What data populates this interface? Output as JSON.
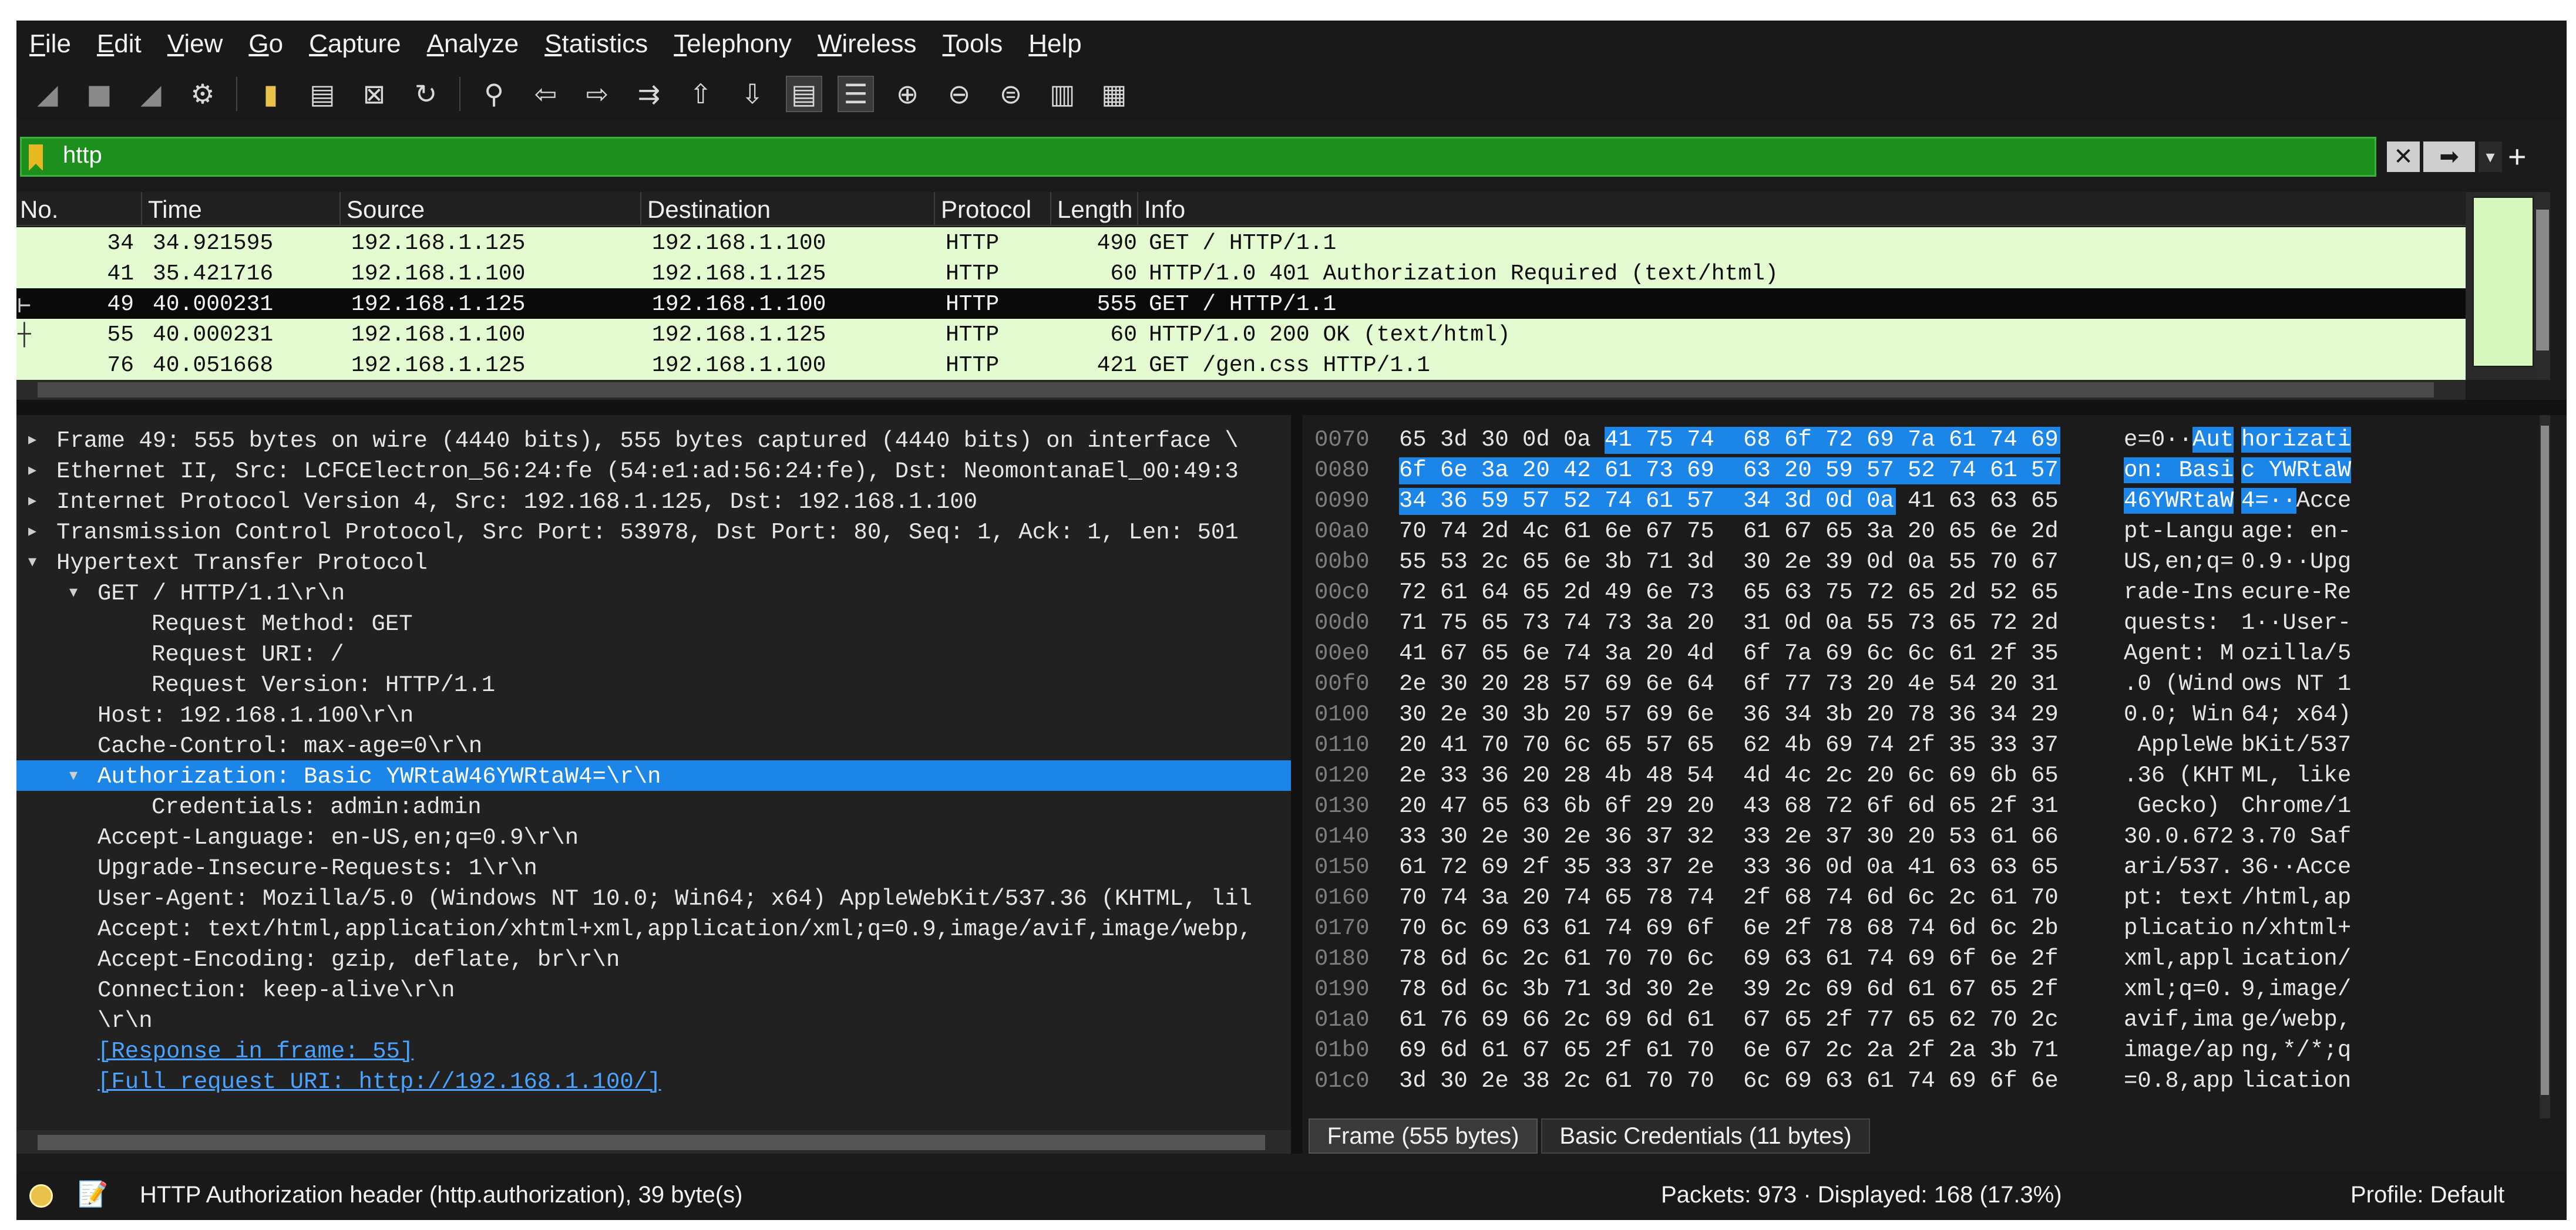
{
  "menu": [
    "File",
    "Edit",
    "View",
    "Go",
    "Capture",
    "Analyze",
    "Statistics",
    "Telephony",
    "Wireless",
    "Tools",
    "Help"
  ],
  "toolbar_icons": [
    "shark-fin-start-icon",
    "stop-icon",
    "restart-icon",
    "options-gear-icon",
    "open-file-icon",
    "save-file-icon",
    "close-file-icon",
    "reload-icon",
    "find-icon",
    "go-back-icon",
    "go-forward-icon",
    "go-to-packet-icon",
    "first-packet-icon",
    "last-packet-icon",
    "autoscroll-icon",
    "colorize-icon",
    "zoom-in-icon",
    "zoom-out-icon",
    "normal-size-icon",
    "resize-columns-icon",
    "layout-icon"
  ],
  "filter": {
    "value": "http"
  },
  "packet_list": {
    "headers": [
      "No.",
      "Time",
      "Source",
      "Destination",
      "Protocol",
      "Length",
      "Info"
    ],
    "rows": [
      {
        "no": "34",
        "time": "34.921595",
        "src": "192.168.1.125",
        "dst": "192.168.1.100",
        "proto": "HTTP",
        "len": "490",
        "info": "GET / HTTP/1.1",
        "selected": false
      },
      {
        "no": "41",
        "time": "35.421716",
        "src": "192.168.1.100",
        "dst": "192.168.1.125",
        "proto": "HTTP",
        "len": "60",
        "info": "HTTP/1.0 401 Authorization Required  (text/html)",
        "selected": false
      },
      {
        "no": "49",
        "time": "40.000231",
        "src": "192.168.1.125",
        "dst": "192.168.1.100",
        "proto": "HTTP",
        "len": "555",
        "info": "GET / HTTP/1.1",
        "selected": true
      },
      {
        "no": "55",
        "time": "40.000231",
        "src": "192.168.1.100",
        "dst": "192.168.1.125",
        "proto": "HTTP",
        "len": "60",
        "info": "HTTP/1.0 200 OK  (text/html)",
        "selected": false
      },
      {
        "no": "76",
        "time": "40.051668",
        "src": "192.168.1.125",
        "dst": "192.168.1.100",
        "proto": "HTTP",
        "len": "421",
        "info": "GET /gen.css HTTP/1.1",
        "selected": false
      }
    ],
    "colors": {
      "row_bg": "#e4fbd2",
      "selected_bg": "#0a0a0a"
    }
  },
  "details": [
    {
      "indent": 0,
      "tri": "▸",
      "text": "Frame 49: 555 bytes on wire (4440 bits), 555 bytes captured (4440 bits) on interface \\"
    },
    {
      "indent": 0,
      "tri": "▸",
      "text": "Ethernet II, Src: LCFCElectron_56:24:fe (54:e1:ad:56:24:fe), Dst: NeomontanaEl_00:49:3"
    },
    {
      "indent": 0,
      "tri": "▸",
      "text": "Internet Protocol Version 4, Src: 192.168.1.125, Dst: 192.168.1.100"
    },
    {
      "indent": 0,
      "tri": "▸",
      "text": "Transmission Control Protocol, Src Port: 53978, Dst Port: 80, Seq: 1, Ack: 1, Len: 501"
    },
    {
      "indent": 0,
      "tri": "▾",
      "text": "Hypertext Transfer Protocol"
    },
    {
      "indent": 1,
      "tri": "▾",
      "text": "GET / HTTP/1.1\\r\\n"
    },
    {
      "indent": 2,
      "tri": "",
      "text": "Request Method: GET"
    },
    {
      "indent": 2,
      "tri": "",
      "text": "Request URI: /"
    },
    {
      "indent": 2,
      "tri": "",
      "text": "Request Version: HTTP/1.1"
    },
    {
      "indent": 1,
      "tri": "",
      "text": "Host: 192.168.1.100\\r\\n"
    },
    {
      "indent": 1,
      "tri": "",
      "text": "Cache-Control: max-age=0\\r\\n"
    },
    {
      "indent": 1,
      "tri": "▾",
      "text": "Authorization: Basic YWRtaW46YWRtaW4=\\r\\n",
      "selected": true
    },
    {
      "indent": 2,
      "tri": "",
      "text": "Credentials: admin:admin"
    },
    {
      "indent": 1,
      "tri": "",
      "text": "Accept-Language: en-US,en;q=0.9\\r\\n"
    },
    {
      "indent": 1,
      "tri": "",
      "text": "Upgrade-Insecure-Requests: 1\\r\\n"
    },
    {
      "indent": 1,
      "tri": "",
      "text": "User-Agent: Mozilla/5.0 (Windows NT 10.0; Win64; x64) AppleWebKit/537.36 (KHTML, lil"
    },
    {
      "indent": 1,
      "tri": "",
      "text": "Accept: text/html,application/xhtml+xml,application/xml;q=0.9,image/avif,image/webp,"
    },
    {
      "indent": 1,
      "tri": "",
      "text": "Accept-Encoding: gzip, deflate, br\\r\\n"
    },
    {
      "indent": 1,
      "tri": "",
      "text": "Connection: keep-alive\\r\\n"
    },
    {
      "indent": 1,
      "tri": "",
      "text": "\\r\\n"
    },
    {
      "indent": 1,
      "tri": "",
      "text": "[Response in frame: 55]",
      "link": true
    },
    {
      "indent": 1,
      "tri": "",
      "text": "[Full request URI: http://192.168.1.100/]",
      "link": true
    }
  ],
  "hex": [
    {
      "off": "0070",
      "bytes": [
        "65",
        "3d",
        "30",
        "0d",
        "0a",
        "41",
        "75",
        "74",
        "68",
        "6f",
        "72",
        "69",
        "7a",
        "61",
        "74",
        "69"
      ],
      "ascii": [
        "e=0··Aut",
        "horizati"
      ],
      "hl": [
        5,
        15
      ]
    },
    {
      "off": "0080",
      "bytes": [
        "6f",
        "6e",
        "3a",
        "20",
        "42",
        "61",
        "73",
        "69",
        "63",
        "20",
        "59",
        "57",
        "52",
        "74",
        "61",
        "57"
      ],
      "ascii": [
        "on: Basi",
        "c YWRtaW"
      ],
      "hl": [
        0,
        15
      ]
    },
    {
      "off": "0090",
      "bytes": [
        "34",
        "36",
        "59",
        "57",
        "52",
        "74",
        "61",
        "57",
        "34",
        "3d",
        "0d",
        "0a",
        "41",
        "63",
        "63",
        "65"
      ],
      "ascii": [
        "46YWRtaW",
        "4=··Acce"
      ],
      "hl": [
        0,
        11
      ]
    },
    {
      "off": "00a0",
      "bytes": [
        "70",
        "74",
        "2d",
        "4c",
        "61",
        "6e",
        "67",
        "75",
        "61",
        "67",
        "65",
        "3a",
        "20",
        "65",
        "6e",
        "2d"
      ],
      "ascii": [
        "pt-Langu",
        "age: en-"
      ]
    },
    {
      "off": "00b0",
      "bytes": [
        "55",
        "53",
        "2c",
        "65",
        "6e",
        "3b",
        "71",
        "3d",
        "30",
        "2e",
        "39",
        "0d",
        "0a",
        "55",
        "70",
        "67"
      ],
      "ascii": [
        "US,en;q=",
        "0.9··Upg"
      ]
    },
    {
      "off": "00c0",
      "bytes": [
        "72",
        "61",
        "64",
        "65",
        "2d",
        "49",
        "6e",
        "73",
        "65",
        "63",
        "75",
        "72",
        "65",
        "2d",
        "52",
        "65"
      ],
      "ascii": [
        "rade-Ins",
        "ecure-Re"
      ]
    },
    {
      "off": "00d0",
      "bytes": [
        "71",
        "75",
        "65",
        "73",
        "74",
        "73",
        "3a",
        "20",
        "31",
        "0d",
        "0a",
        "55",
        "73",
        "65",
        "72",
        "2d"
      ],
      "ascii": [
        "quests: ",
        "1··User-"
      ]
    },
    {
      "off": "00e0",
      "bytes": [
        "41",
        "67",
        "65",
        "6e",
        "74",
        "3a",
        "20",
        "4d",
        "6f",
        "7a",
        "69",
        "6c",
        "6c",
        "61",
        "2f",
        "35"
      ],
      "ascii": [
        "Agent: M",
        "ozilla/5"
      ]
    },
    {
      "off": "00f0",
      "bytes": [
        "2e",
        "30",
        "20",
        "28",
        "57",
        "69",
        "6e",
        "64",
        "6f",
        "77",
        "73",
        "20",
        "4e",
        "54",
        "20",
        "31"
      ],
      "ascii": [
        ".0 (Wind",
        "ows NT 1"
      ]
    },
    {
      "off": "0100",
      "bytes": [
        "30",
        "2e",
        "30",
        "3b",
        "20",
        "57",
        "69",
        "6e",
        "36",
        "34",
        "3b",
        "20",
        "78",
        "36",
        "34",
        "29"
      ],
      "ascii": [
        "0.0; Win",
        "64; x64)"
      ]
    },
    {
      "off": "0110",
      "bytes": [
        "20",
        "41",
        "70",
        "70",
        "6c",
        "65",
        "57",
        "65",
        "62",
        "4b",
        "69",
        "74",
        "2f",
        "35",
        "33",
        "37"
      ],
      "ascii": [
        " AppleWe",
        "bKit/537"
      ]
    },
    {
      "off": "0120",
      "bytes": [
        "2e",
        "33",
        "36",
        "20",
        "28",
        "4b",
        "48",
        "54",
        "4d",
        "4c",
        "2c",
        "20",
        "6c",
        "69",
        "6b",
        "65"
      ],
      "ascii": [
        ".36 (KHT",
        "ML, like"
      ]
    },
    {
      "off": "0130",
      "bytes": [
        "20",
        "47",
        "65",
        "63",
        "6b",
        "6f",
        "29",
        "20",
        "43",
        "68",
        "72",
        "6f",
        "6d",
        "65",
        "2f",
        "31"
      ],
      "ascii": [
        " Gecko) ",
        "Chrome/1"
      ]
    },
    {
      "off": "0140",
      "bytes": [
        "33",
        "30",
        "2e",
        "30",
        "2e",
        "36",
        "37",
        "32",
        "33",
        "2e",
        "37",
        "30",
        "20",
        "53",
        "61",
        "66"
      ],
      "ascii": [
        "30.0.672",
        "3.70 Saf"
      ]
    },
    {
      "off": "0150",
      "bytes": [
        "61",
        "72",
        "69",
        "2f",
        "35",
        "33",
        "37",
        "2e",
        "33",
        "36",
        "0d",
        "0a",
        "41",
        "63",
        "63",
        "65"
      ],
      "ascii": [
        "ari/537.",
        "36··Acce"
      ]
    },
    {
      "off": "0160",
      "bytes": [
        "70",
        "74",
        "3a",
        "20",
        "74",
        "65",
        "78",
        "74",
        "2f",
        "68",
        "74",
        "6d",
        "6c",
        "2c",
        "61",
        "70"
      ],
      "ascii": [
        "pt: text",
        "/html,ap"
      ]
    },
    {
      "off": "0170",
      "bytes": [
        "70",
        "6c",
        "69",
        "63",
        "61",
        "74",
        "69",
        "6f",
        "6e",
        "2f",
        "78",
        "68",
        "74",
        "6d",
        "6c",
        "2b"
      ],
      "ascii": [
        "plicatio",
        "n/xhtml+"
      ]
    },
    {
      "off": "0180",
      "bytes": [
        "78",
        "6d",
        "6c",
        "2c",
        "61",
        "70",
        "70",
        "6c",
        "69",
        "63",
        "61",
        "74",
        "69",
        "6f",
        "6e",
        "2f"
      ],
      "ascii": [
        "xml,appl",
        "ication/"
      ]
    },
    {
      "off": "0190",
      "bytes": [
        "78",
        "6d",
        "6c",
        "3b",
        "71",
        "3d",
        "30",
        "2e",
        "39",
        "2c",
        "69",
        "6d",
        "61",
        "67",
        "65",
        "2f"
      ],
      "ascii": [
        "xml;q=0.",
        "9,image/"
      ]
    },
    {
      "off": "01a0",
      "bytes": [
        "61",
        "76",
        "69",
        "66",
        "2c",
        "69",
        "6d",
        "61",
        "67",
        "65",
        "2f",
        "77",
        "65",
        "62",
        "70",
        "2c"
      ],
      "ascii": [
        "avif,ima",
        "ge/webp,"
      ]
    },
    {
      "off": "01b0",
      "bytes": [
        "69",
        "6d",
        "61",
        "67",
        "65",
        "2f",
        "61",
        "70",
        "6e",
        "67",
        "2c",
        "2a",
        "2f",
        "2a",
        "3b",
        "71"
      ],
      "ascii": [
        "image/ap",
        "ng,*/*;q"
      ]
    },
    {
      "off": "01c0",
      "bytes": [
        "3d",
        "30",
        "2e",
        "38",
        "2c",
        "61",
        "70",
        "70",
        "6c",
        "69",
        "63",
        "61",
        "74",
        "69",
        "6f",
        "6e"
      ],
      "ascii": [
        "=0.8,app",
        "lication"
      ]
    }
  ],
  "tabs": [
    "Frame (555 bytes)",
    "Basic Credentials (11 bytes)"
  ],
  "status": {
    "field": "HTTP Authorization header (http.authorization), 39 byte(s)",
    "packets": "Packets: 973 · Displayed: 168 (17.3%)",
    "profile": "Profile: Default"
  }
}
